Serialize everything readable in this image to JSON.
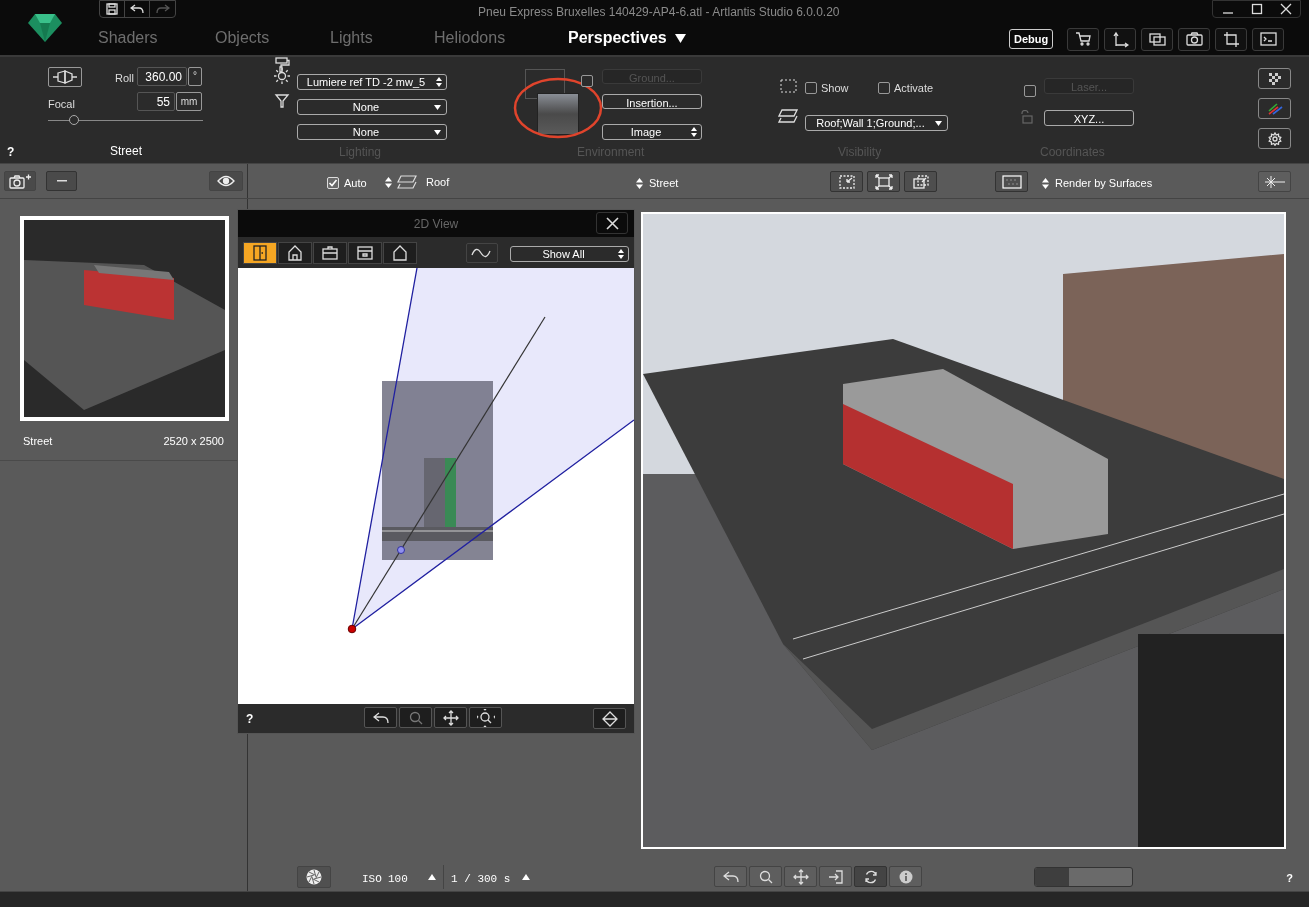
{
  "window": {
    "title": "Pneu Express Bruxelles 140429-AP4-6.atl - Artlantis Studio 6.0.0.20"
  },
  "tabs": [
    {
      "label": "Shaders",
      "selected": false
    },
    {
      "label": "Objects",
      "selected": false
    },
    {
      "label": "Lights",
      "selected": false
    },
    {
      "label": "Heliodons",
      "selected": false
    },
    {
      "label": "Perspectives",
      "selected": true
    }
  ],
  "debug_button": "Debug",
  "camera": {
    "roll_label": "Roll",
    "roll": "360.00",
    "roll_unit": "°",
    "focal_label": "Focal",
    "focal": "55",
    "focal_unit": "mm",
    "focal_slider": {
      "level": 0.17
    },
    "name": "Street",
    "help": "?"
  },
  "lighting": {
    "light": "Lumiere ref TD -2 mw_5",
    "light_2": "None",
    "light_3": "None",
    "title": "Lighting"
  },
  "environment": {
    "ground": {
      "label": "Ground...",
      "checked": false,
      "disabled": true
    },
    "insertion": "Insertion...",
    "background": "Image",
    "title": "Environment"
  },
  "visibility": {
    "show": {
      "label": "Show",
      "checked": false
    },
    "activate": {
      "label": "Activate",
      "checked": false
    },
    "layers": "Roof;Wall 1;Ground;...",
    "title": "Visibility"
  },
  "coordinates": {
    "laser": {
      "label": "Laser...",
      "checked": false,
      "disabled": true
    },
    "xyz": "XYZ...",
    "title": "Coordinates"
  },
  "subtoolbar": {
    "auto": {
      "label": "Auto",
      "checked": true
    },
    "layer": "Roof",
    "view": "Street",
    "render_mode": "Render by Surfaces"
  },
  "views": [
    {
      "name": "Street",
      "size": "2520 x 2500",
      "selected": true
    }
  ],
  "view2d": {
    "title": "2D View",
    "tools": [
      {
        "kind": "split",
        "selected": true
      },
      {
        "kind": "house",
        "selected": false
      },
      {
        "kind": "top",
        "selected": false
      },
      {
        "kind": "bottom",
        "selected": false
      },
      {
        "kind": "roof",
        "selected": false
      }
    ],
    "filter": "Show All",
    "help": "?"
  },
  "bottom": {
    "iso_label": "ISO",
    "iso": "100",
    "shutter": "1 / 300 s",
    "zoom_slider": {
      "level": 0.35
    },
    "help": "?"
  }
}
